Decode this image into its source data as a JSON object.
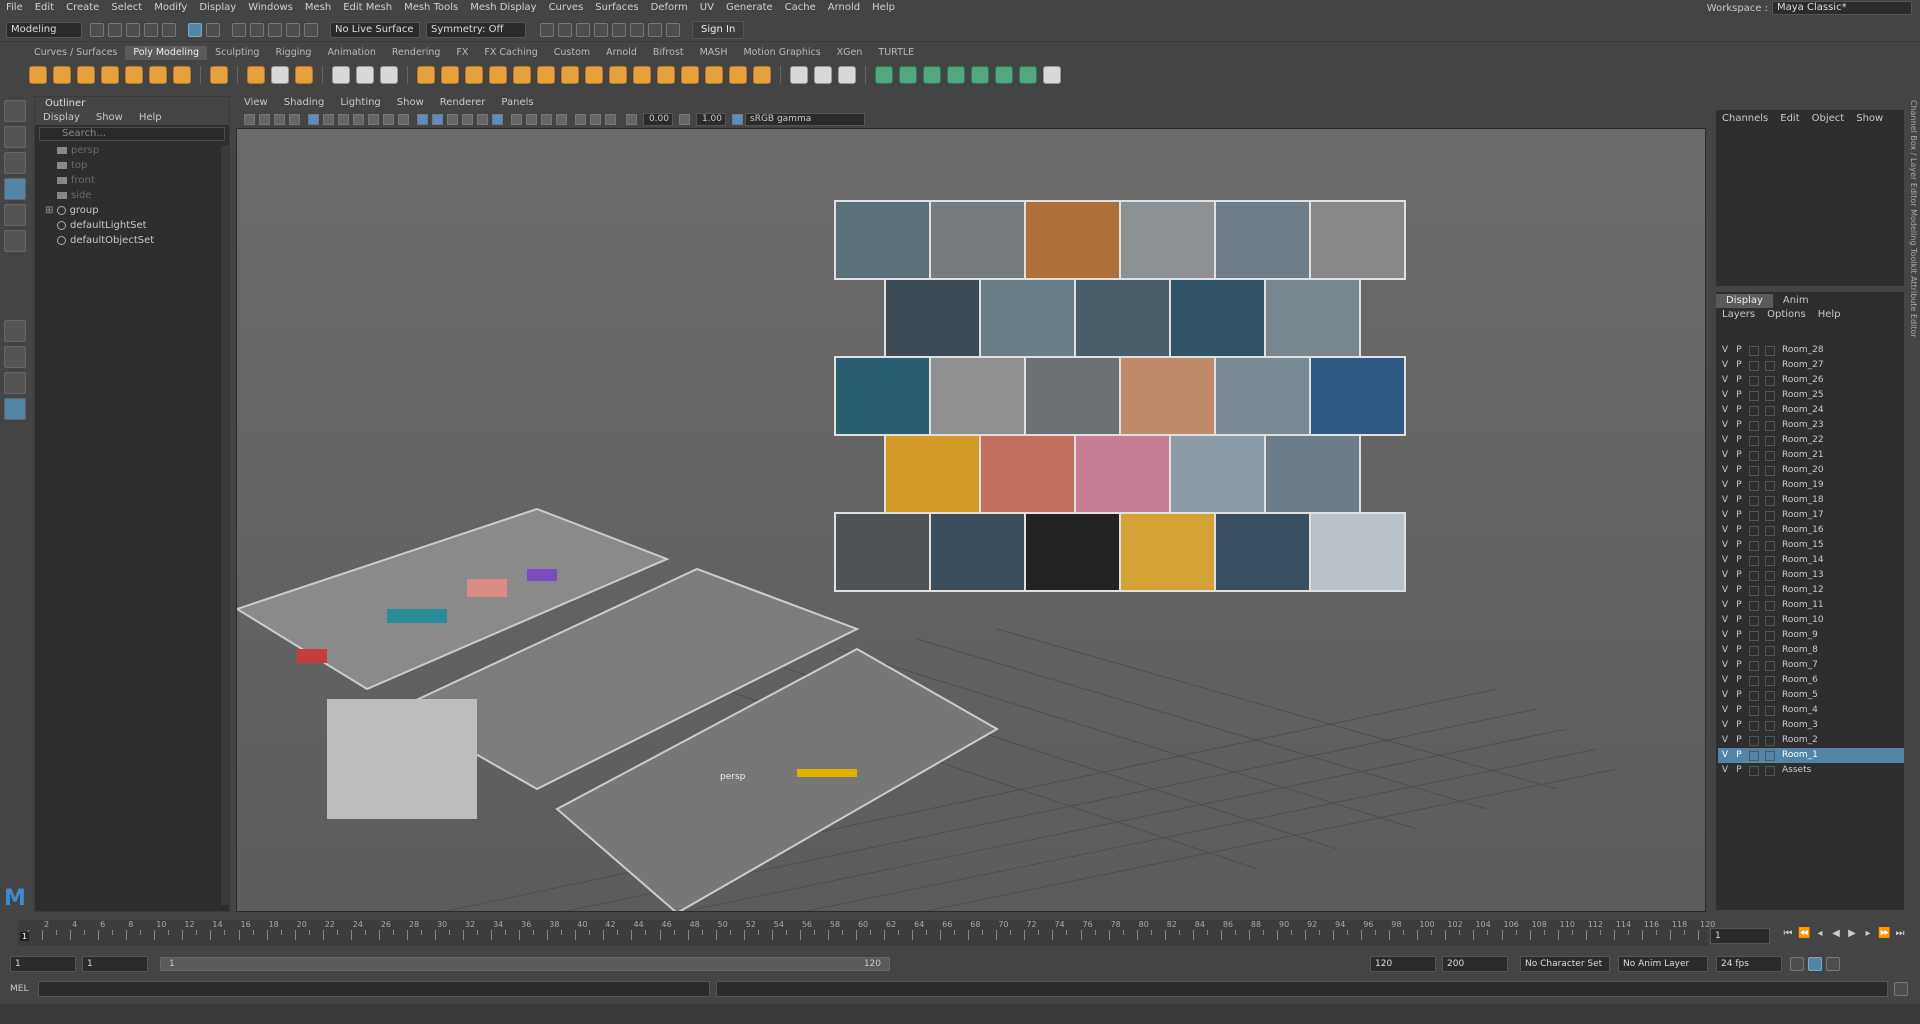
{
  "menubar": {
    "items": [
      "File",
      "Edit",
      "Create",
      "Select",
      "Modify",
      "Display",
      "Windows",
      "Mesh",
      "Edit Mesh",
      "Mesh Tools",
      "Mesh Display",
      "Curves",
      "Surfaces",
      "Deform",
      "UV",
      "Generate",
      "Cache",
      "Arnold",
      "Help"
    ],
    "workspace_label": "Workspace :",
    "workspace_value": "Maya Classic*"
  },
  "statusline": {
    "mode": "Modeling",
    "live_surface": "No Live Surface",
    "symmetry": "Symmetry: Off",
    "sign_in": "Sign In"
  },
  "shelf": {
    "tabs": [
      "Curves / Surfaces",
      "Poly Modeling",
      "Sculpting",
      "Rigging",
      "Animation",
      "Rendering",
      "FX",
      "FX Caching",
      "Custom",
      "Arnold",
      "Bifrost",
      "MASH",
      "Motion Graphics",
      "XGen",
      "TURTLE"
    ],
    "active_tab": "Poly Modeling"
  },
  "outliner": {
    "title": "Outliner",
    "menu": [
      "Display",
      "Show",
      "Help"
    ],
    "search_placeholder": "Search...",
    "items": [
      {
        "label": "persp",
        "kind": "camera",
        "dim": true
      },
      {
        "label": "top",
        "kind": "camera",
        "dim": true
      },
      {
        "label": "front",
        "kind": "camera",
        "dim": true
      },
      {
        "label": "side",
        "kind": "camera",
        "dim": true
      },
      {
        "label": "group",
        "kind": "group",
        "dim": false
      },
      {
        "label": "defaultLightSet",
        "kind": "set",
        "dim": false
      },
      {
        "label": "defaultObjectSet",
        "kind": "set",
        "dim": false
      }
    ]
  },
  "viewport": {
    "menu": [
      "View",
      "Shading",
      "Lighting",
      "Show",
      "Renderer",
      "Panels"
    ],
    "exposure": "0.00",
    "gamma": "1.00",
    "colorspace": "sRGB gamma",
    "camera_label": "persp"
  },
  "channelbox": {
    "menu": [
      "Channels",
      "Edit",
      "Object",
      "Show"
    ]
  },
  "layers": {
    "tabs": [
      "Display",
      "Anim"
    ],
    "active_tab": "Display",
    "menu": [
      "Layers",
      "Options",
      "Help"
    ],
    "rows": [
      "Room_28",
      "Room_27",
      "Room_26",
      "Room_25",
      "Room_24",
      "Room_23",
      "Room_22",
      "Room_21",
      "Room_20",
      "Room_19",
      "Room_18",
      "Room_17",
      "Room_16",
      "Room_15",
      "Room_14",
      "Room_13",
      "Room_12",
      "Room_11",
      "Room_10",
      "Room_9",
      "Room_8",
      "Room_7",
      "Room_6",
      "Room_5",
      "Room_4",
      "Room_3",
      "Room_2",
      "Room_1",
      "Assets"
    ],
    "selected": "Room_1",
    "v": "V",
    "p": "P"
  },
  "sidetabs": "Channel Box / Layer Editor   Modeling Toolkit   Attribute Editor",
  "timeline": {
    "tick_labels": [
      "2",
      "4",
      "6",
      "8",
      "10",
      "12",
      "14",
      "16",
      "18",
      "20",
      "22",
      "24",
      "26",
      "28",
      "30",
      "32",
      "34",
      "36",
      "38",
      "40",
      "42",
      "44",
      "46",
      "48",
      "50",
      "52",
      "54",
      "56",
      "58",
      "60",
      "62",
      "64",
      "66",
      "68",
      "70",
      "72",
      "74",
      "76",
      "78",
      "80",
      "82",
      "84",
      "86",
      "88",
      "90",
      "92",
      "94",
      "96",
      "98",
      "100",
      "102",
      "104",
      "106",
      "108",
      "110",
      "112",
      "114",
      "116",
      "118",
      "120"
    ],
    "current_frame": "1",
    "start_marker": "1"
  },
  "range": {
    "start": "1",
    "playback_start": "1",
    "slider_start": "1",
    "slider_end": "120",
    "playback_end": "120",
    "end": "200",
    "character_set": "No Character Set",
    "anim_layer": "No Anim Layer",
    "fps": "24 fps"
  },
  "cmdline": {
    "lang": "MEL"
  },
  "colors": {
    "accent": "#5285a6",
    "shelf_orange": "#e8a03c"
  }
}
